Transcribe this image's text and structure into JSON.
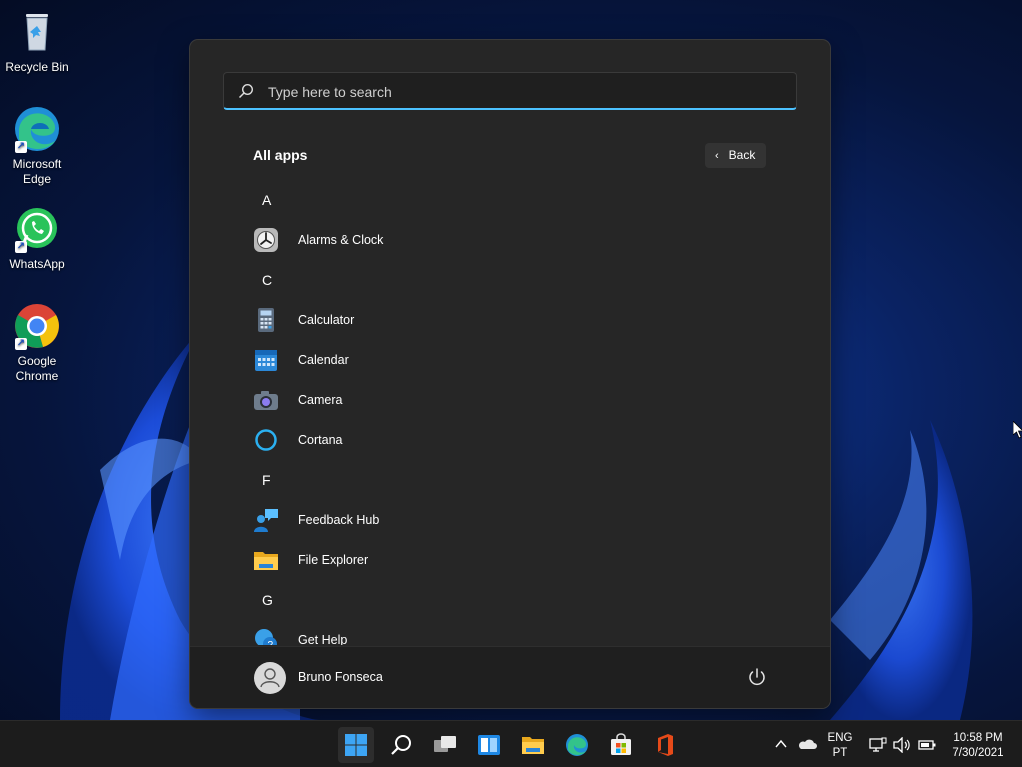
{
  "desktop": {
    "icons": [
      {
        "label": "Recycle Bin"
      },
      {
        "label": "Microsoft Edge"
      },
      {
        "label": "WhatsApp"
      },
      {
        "label": "Google Chrome"
      }
    ]
  },
  "start_menu": {
    "search": {
      "placeholder": "Type here to search"
    },
    "section_title": "All apps",
    "back_label": "Back",
    "groups": [
      {
        "letter": "A",
        "apps": [
          {
            "label": "Alarms & Clock",
            "icon": "clock-icon"
          }
        ]
      },
      {
        "letter": "C",
        "apps": [
          {
            "label": "Calculator",
            "icon": "calculator-icon"
          },
          {
            "label": "Calendar",
            "icon": "calendar-icon"
          },
          {
            "label": "Camera",
            "icon": "camera-icon"
          },
          {
            "label": "Cortana",
            "icon": "cortana-icon"
          }
        ]
      },
      {
        "letter": "F",
        "apps": [
          {
            "label": "Feedback Hub",
            "icon": "feedback-hub-icon"
          },
          {
            "label": "File Explorer",
            "icon": "folder-icon"
          }
        ]
      },
      {
        "letter": "G",
        "apps": [
          {
            "label": "Get Help",
            "icon": "get-help-icon"
          }
        ]
      }
    ],
    "user": {
      "name": "Bruno Fonseca"
    }
  },
  "taskbar": {
    "apps": [
      "start-icon",
      "search-icon",
      "task-view-icon",
      "widgets-icon",
      "file-explorer-icon",
      "edge-icon",
      "store-icon",
      "office-icon"
    ],
    "language": {
      "line1": "ENG",
      "line2": "PT"
    },
    "clock": {
      "time": "10:58 PM",
      "date": "7/30/2021"
    }
  },
  "colors": {
    "accent": "#4cc2ff",
    "start_bg": "#262626",
    "taskbar_bg": "#1c1c1c"
  }
}
